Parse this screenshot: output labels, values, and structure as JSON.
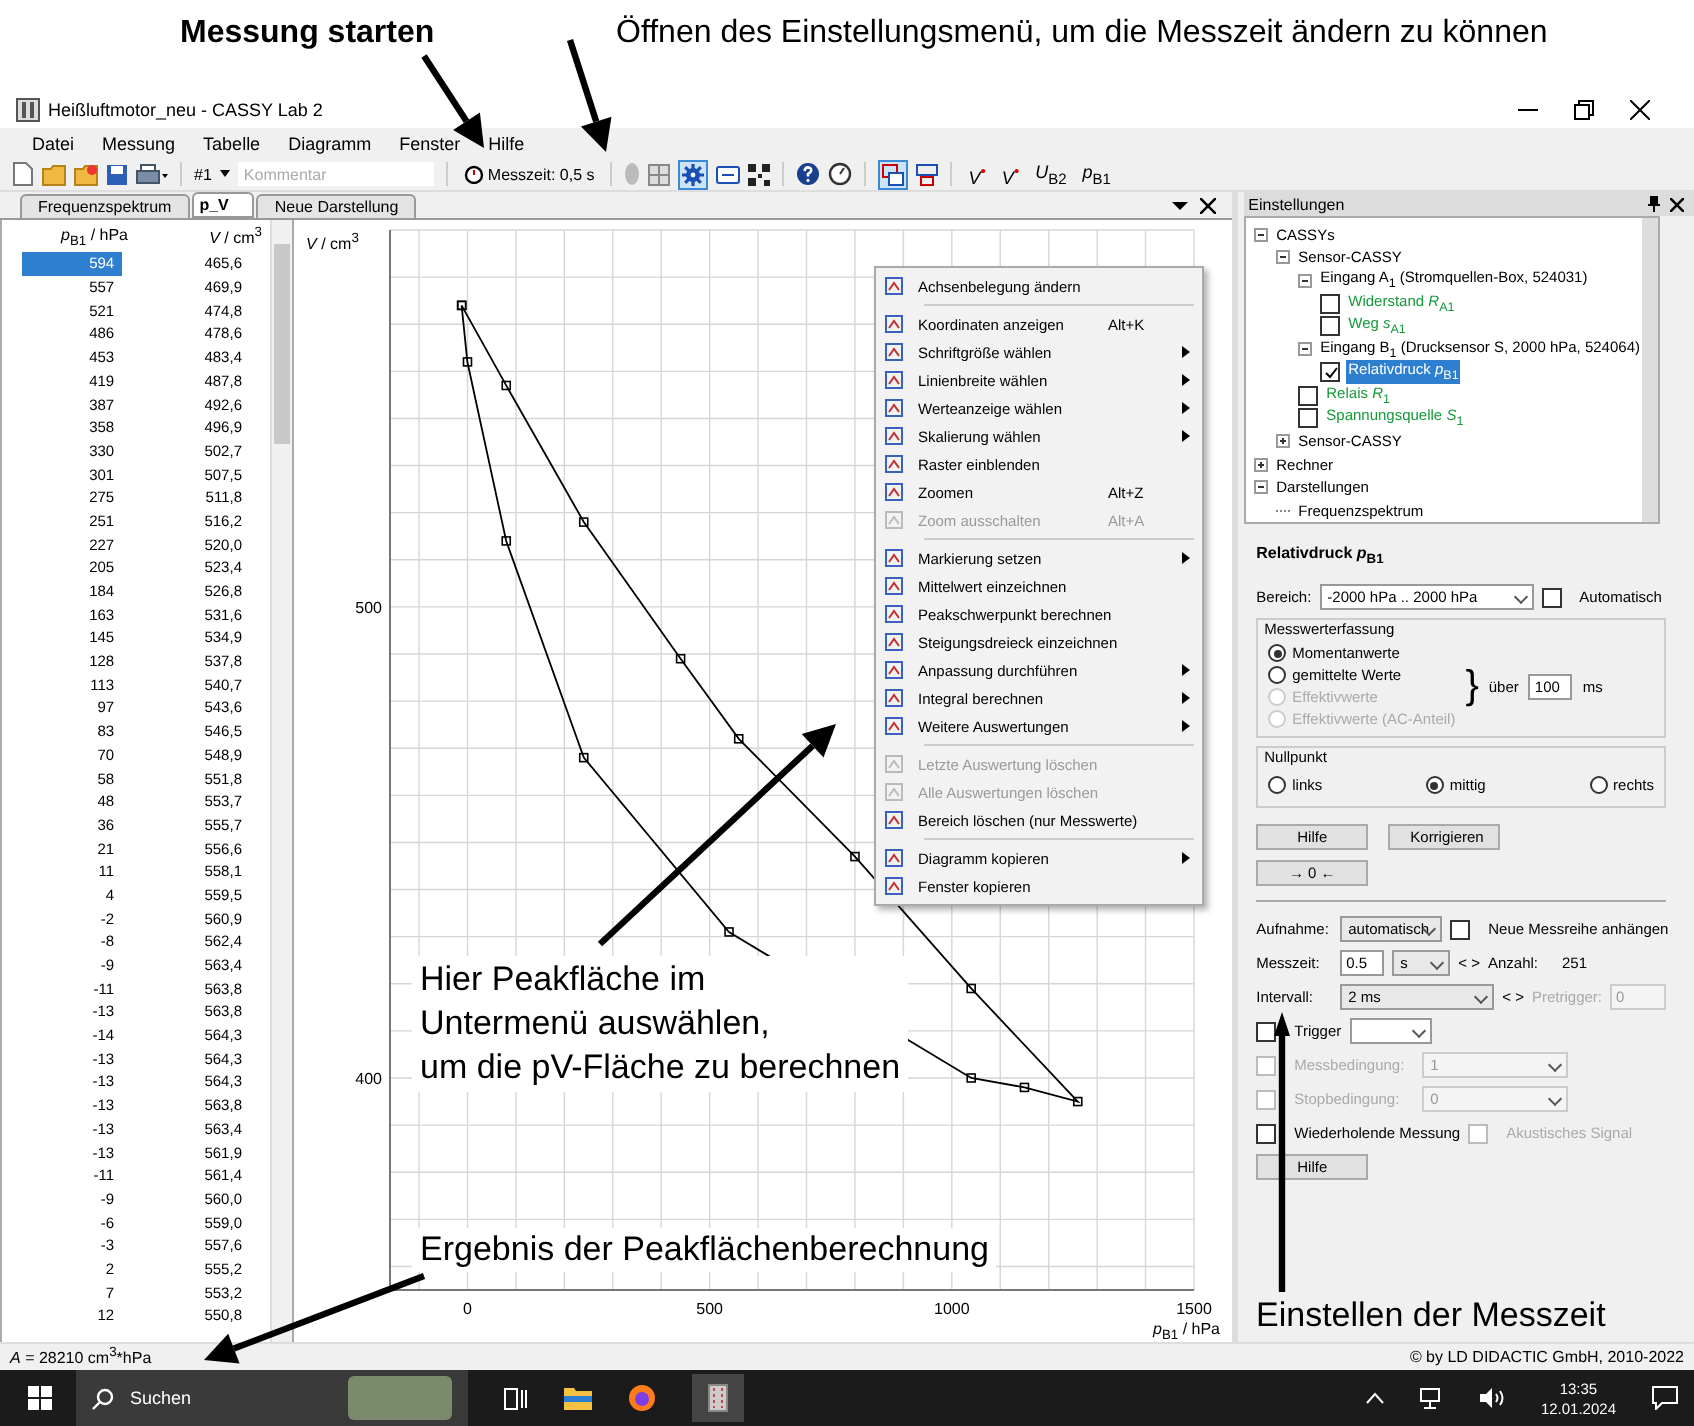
{
  "annotations": {
    "start": "Messung starten",
    "settings": "Öffnen des Einstellungsmenü, um die Messzeit ändern zu können",
    "peak_lines": [
      "Hier Peakfläche im",
      "Untermenü auswählen,",
      "um die pV-Fläche zu berechnen"
    ],
    "result": "Ergebnis der Peakflächenberechnung",
    "time": "Einstellen der Messzeit"
  },
  "window": {
    "title": "Heißluftmotor_neu - CASSY Lab 2"
  },
  "menu": [
    "Datei",
    "Messung",
    "Tabelle",
    "Diagramm",
    "Fenster",
    "Hilfe"
  ],
  "toolbar": {
    "series": "#1",
    "comment_placeholder": "Kommentar",
    "measure_button": "Messzeit: 0,5 s",
    "quantities": [
      "*V*$^{•}$",
      "*V*$^{•}$",
      "*U*$_{B2}$",
      "*p*$_{B1}$"
    ]
  },
  "tabs": [
    {
      "label": "Frequenzspektrum",
      "selected": false
    },
    {
      "label": "p_V",
      "selected": true
    },
    {
      "label": "Neue Darstellung",
      "selected": false
    }
  ],
  "table": {
    "columns": [
      "*p*$_{B1}$ / hPa",
      "*V* / cm$^{3}$"
    ],
    "rows": [
      {
        "cells": [
          "594",
          "465,6"
        ],
        "selected": true
      },
      {
        "cells": [
          "557",
          "469,9"
        ],
        "selected": false
      },
      {
        "cells": [
          "521",
          "474,8"
        ],
        "selected": false
      },
      {
        "cells": [
          "486",
          "478,6"
        ],
        "selected": false
      },
      {
        "cells": [
          "453",
          "483,4"
        ],
        "selected": false
      },
      {
        "cells": [
          "419",
          "487,8"
        ],
        "selected": false
      },
      {
        "cells": [
          "387",
          "492,6"
        ],
        "selected": false
      },
      {
        "cells": [
          "358",
          "496,9"
        ],
        "selected": false
      },
      {
        "cells": [
          "330",
          "502,7"
        ],
        "selected": false
      },
      {
        "cells": [
          "301",
          "507,5"
        ],
        "selected": false
      },
      {
        "cells": [
          "275",
          "511,8"
        ],
        "selected": false
      },
      {
        "cells": [
          "251",
          "516,2"
        ],
        "selected": false
      },
      {
        "cells": [
          "227",
          "520,0"
        ],
        "selected": false
      },
      {
        "cells": [
          "205",
          "523,4"
        ],
        "selected": false
      },
      {
        "cells": [
          "184",
          "526,8"
        ],
        "selected": false
      },
      {
        "cells": [
          "163",
          "531,6"
        ],
        "selected": false
      },
      {
        "cells": [
          "145",
          "534,9"
        ],
        "selected": false
      },
      {
        "cells": [
          "128",
          "537,8"
        ],
        "selected": false
      },
      {
        "cells": [
          "113",
          "540,7"
        ],
        "selected": false
      },
      {
        "cells": [
          "97",
          "543,6"
        ],
        "selected": false
      },
      {
        "cells": [
          "83",
          "546,5"
        ],
        "selected": false
      },
      {
        "cells": [
          "70",
          "548,9"
        ],
        "selected": false
      },
      {
        "cells": [
          "58",
          "551,8"
        ],
        "selected": false
      },
      {
        "cells": [
          "48",
          "553,7"
        ],
        "selected": false
      },
      {
        "cells": [
          "36",
          "555,7"
        ],
        "selected": false
      },
      {
        "cells": [
          "21",
          "556,6"
        ],
        "selected": false
      },
      {
        "cells": [
          "11",
          "558,1"
        ],
        "selected": false
      },
      {
        "cells": [
          "4",
          "559,5"
        ],
        "selected": false
      },
      {
        "cells": [
          "-2",
          "560,9"
        ],
        "selected": false
      },
      {
        "cells": [
          "-8",
          "562,4"
        ],
        "selected": false
      },
      {
        "cells": [
          "-9",
          "563,4"
        ],
        "selected": false
      },
      {
        "cells": [
          "-11",
          "563,8"
        ],
        "selected": false
      },
      {
        "cells": [
          "-13",
          "563,8"
        ],
        "selected": false
      },
      {
        "cells": [
          "-14",
          "564,3"
        ],
        "selected": false
      },
      {
        "cells": [
          "-13",
          "564,3"
        ],
        "selected": false
      },
      {
        "cells": [
          "-13",
          "564,3"
        ],
        "selected": false
      },
      {
        "cells": [
          "-13",
          "563,8"
        ],
        "selected": false
      },
      {
        "cells": [
          "-13",
          "563,4"
        ],
        "selected": false
      },
      {
        "cells": [
          "-13",
          "561,9"
        ],
        "selected": false
      },
      {
        "cells": [
          "-11",
          "561,4"
        ],
        "selected": false
      },
      {
        "cells": [
          "-9",
          "560,0"
        ],
        "selected": false
      },
      {
        "cells": [
          "-6",
          "559,0"
        ],
        "selected": false
      },
      {
        "cells": [
          "-3",
          "557,6"
        ],
        "selected": false
      },
      {
        "cells": [
          "2",
          "555,2"
        ],
        "selected": false
      },
      {
        "cells": [
          "7",
          "553,2"
        ],
        "selected": false
      },
      {
        "cells": [
          "12",
          "550,8"
        ],
        "selected": false
      }
    ]
  },
  "chart": {
    "chart_data": {
      "type": "scatter",
      "xlabel": "*p*$_{B1}$ / hPa",
      "ylabel": "*V* / cm$^{3}$",
      "x": [
        -12,
        80,
        240,
        440,
        560,
        800,
        1040,
        1260,
        1150,
        1040,
        540,
        240,
        80,
        0,
        -12
      ],
      "grid": true,
      "series": [
        {
          "color": "#000000",
          "values": [
            564,
            547,
            518,
            489,
            472,
            447,
            419,
            395,
            398,
            400,
            431,
            468,
            514,
            552,
            564
          ]
        }
      ],
      "xlim": [
        -160,
        1500
      ],
      "ylim": [
        355,
        580
      ],
      "xticks": [
        0,
        500,
        1000,
        1500
      ],
      "yticks": [
        400,
        500
      ]
    }
  },
  "context_menu": [
    {
      "kind": "item",
      "label": "Achsenbelegung ändern",
      "disabled": false,
      "submenu": false
    },
    {
      "kind": "separator"
    },
    {
      "kind": "item",
      "label": "Koordinaten anzeigen",
      "shortcut": "Alt+K",
      "disabled": false,
      "submenu": false
    },
    {
      "kind": "item",
      "label": "Schriftgröße wählen",
      "disabled": false,
      "submenu": true
    },
    {
      "kind": "item",
      "label": "Linienbreite wählen",
      "disabled": false,
      "submenu": true
    },
    {
      "kind": "item",
      "label": "Werteanzeige wählen",
      "disabled": false,
      "submenu": true
    },
    {
      "kind": "item",
      "label": "Skalierung wählen",
      "disabled": false,
      "submenu": true
    },
    {
      "kind": "item",
      "label": "Raster einblenden",
      "disabled": false,
      "submenu": false
    },
    {
      "kind": "item",
      "label": "Zoomen",
      "shortcut": "Alt+Z",
      "disabled": false,
      "submenu": false
    },
    {
      "kind": "item",
      "label": "Zoom ausschalten",
      "shortcut": "Alt+A",
      "disabled": true,
      "submenu": false
    },
    {
      "kind": "separator"
    },
    {
      "kind": "item",
      "label": "Markierung setzen",
      "disabled": false,
      "submenu": true
    },
    {
      "kind": "item",
      "label": "Mittelwert einzeichnen",
      "disabled": false,
      "submenu": false
    },
    {
      "kind": "item",
      "label": "Peakschwerpunkt berechnen",
      "disabled": false,
      "submenu": false
    },
    {
      "kind": "item",
      "label": "Steigungsdreieck einzeichnen",
      "disabled": false,
      "submenu": false
    },
    {
      "kind": "item",
      "label": "Anpassung durchführen",
      "disabled": false,
      "submenu": true
    },
    {
      "kind": "item",
      "label": "Integral berechnen",
      "disabled": false,
      "submenu": true
    },
    {
      "kind": "item",
      "label": "Weitere Auswertungen",
      "disabled": false,
      "submenu": true
    },
    {
      "kind": "separator"
    },
    {
      "kind": "item",
      "label": "Letzte Auswertung löschen",
      "disabled": true,
      "submenu": false
    },
    {
      "kind": "item",
      "label": "Alle Auswertungen löschen",
      "disabled": true,
      "submenu": false
    },
    {
      "kind": "item",
      "label": "Bereich löschen (nur Messwerte)",
      "disabled": false,
      "submenu": false
    },
    {
      "kind": "separator"
    },
    {
      "kind": "item",
      "label": "Diagramm kopieren",
      "disabled": false,
      "submenu": true
    },
    {
      "kind": "item",
      "label": "Fenster kopieren",
      "disabled": false,
      "submenu": false
    }
  ],
  "settings": {
    "title": "Einstellungen",
    "tree": [
      {
        "label": "CASSYs",
        "kind": "group",
        "expanded": true,
        "selected": false,
        "children": [
          {
            "label": "Sensor-CASSY",
            "kind": "group",
            "expanded": true,
            "selected": false,
            "children": [
              {
                "label": "Eingang A$_{1}$ (Stromquellen-Box, 524031)",
                "kind": "group",
                "expanded": true,
                "selected": false,
                "children": [
                  {
                    "label": "Widerstand *R*$_{A1}$",
                    "kind": "channel",
                    "checked": false,
                    "selected": false
                  },
                  {
                    "label": "Weg *s*$_{A1}$",
                    "kind": "channel",
                    "checked": false,
                    "selected": false
                  }
                ]
              },
              {
                "label": "Eingang B$_{1}$ (Drucksensor S, 2000 hPa, 524064)",
                "kind": "group",
                "expanded": true,
                "selected": false,
                "children": [
                  {
                    "label": "Relativdruck *p*$_{B1}$",
                    "kind": "channel",
                    "checked": true,
                    "selected": true
                  }
                ]
              },
              {
                "label": "Relais *R*$_{1}$",
                "kind": "channel",
                "checked": false,
                "selected": false
              },
              {
                "label": "Spannungsquelle *S*$_{1}$",
                "kind": "channel",
                "checked": false,
                "selected": false
              }
            ]
          },
          {
            "label": "Sensor-CASSY",
            "kind": "group",
            "expanded": false,
            "selected": false
          }
        ]
      },
      {
        "label": "Rechner",
        "kind": "group",
        "expanded": false,
        "selected": false
      },
      {
        "label": "Darstellungen",
        "kind": "group",
        "expanded": true,
        "selected": false,
        "children": [
          {
            "label": "Frequenzspektrum",
            "kind": "leaf",
            "selected": false
          }
        ]
      }
    ],
    "form": {
      "title": "Relativdruck *p*$_{B1}$",
      "range": {
        "label": "Bereich:",
        "value": "-2000 hPa .. 2000 hPa"
      },
      "auto": {
        "label": "Automatisch",
        "checked": false
      },
      "acquisition": {
        "title": "Messwerterfassung",
        "options": [
          {
            "label": "Momentanwerte",
            "selected": true,
            "disabled": false
          },
          {
            "label": "gemittelte Werte",
            "selected": false,
            "disabled": false
          },
          {
            "label": "Effektivwerte",
            "selected": false,
            "disabled": true
          },
          {
            "label": "Effektivwerte (AC-Anteil)",
            "selected": false,
            "disabled": true
          }
        ],
        "brace": "}",
        "over_label": "über",
        "over_value": "100",
        "over_unit": "ms"
      },
      "zero": {
        "title": "Nullpunkt",
        "options": [
          {
            "label": "links",
            "selected": false
          },
          {
            "label": "mittig",
            "selected": true
          },
          {
            "label": "rechts",
            "selected": false
          }
        ]
      },
      "buttons": [
        "Hilfe",
        "Korrigieren",
        "→ 0 ←"
      ],
      "recording": {
        "label": "Aufnahme:",
        "value": "automatisch"
      },
      "append": {
        "label": "Neue Messreihe anhängen",
        "checked": false
      },
      "measure_time": {
        "label": "Messzeit:",
        "value": "0.5",
        "unit": "s",
        "stepper": "< >",
        "count_label": "Anzahl:",
        "count": "251"
      },
      "interval": {
        "label": "Intervall:",
        "value": "2 ms",
        "stepper": "< >",
        "pretrigger_label": "Pretrigger:",
        "pretrigger": "0"
      },
      "trigger": {
        "label": "Trigger",
        "checked": false
      },
      "conditions": [
        {
          "label": "Messbedingung:",
          "value": "1",
          "checked": false
        },
        {
          "label": "Stopbedingung:",
          "value": "0",
          "checked": false
        }
      ],
      "repeat": {
        "label": "Wiederholende Messung",
        "checked": false
      },
      "acoustic": {
        "label": "Akustisches Signal",
        "checked": false
      },
      "help": "Hilfe"
    }
  },
  "status_bar": {
    "result": "*A* = 28210 cm$^{3}$*hPa",
    "copyright": "© by LD DIDACTIC GmbH, 2010-2022"
  },
  "taskbar": {
    "search": "Suchen",
    "time": "13:35",
    "date": "12.01.2024"
  }
}
